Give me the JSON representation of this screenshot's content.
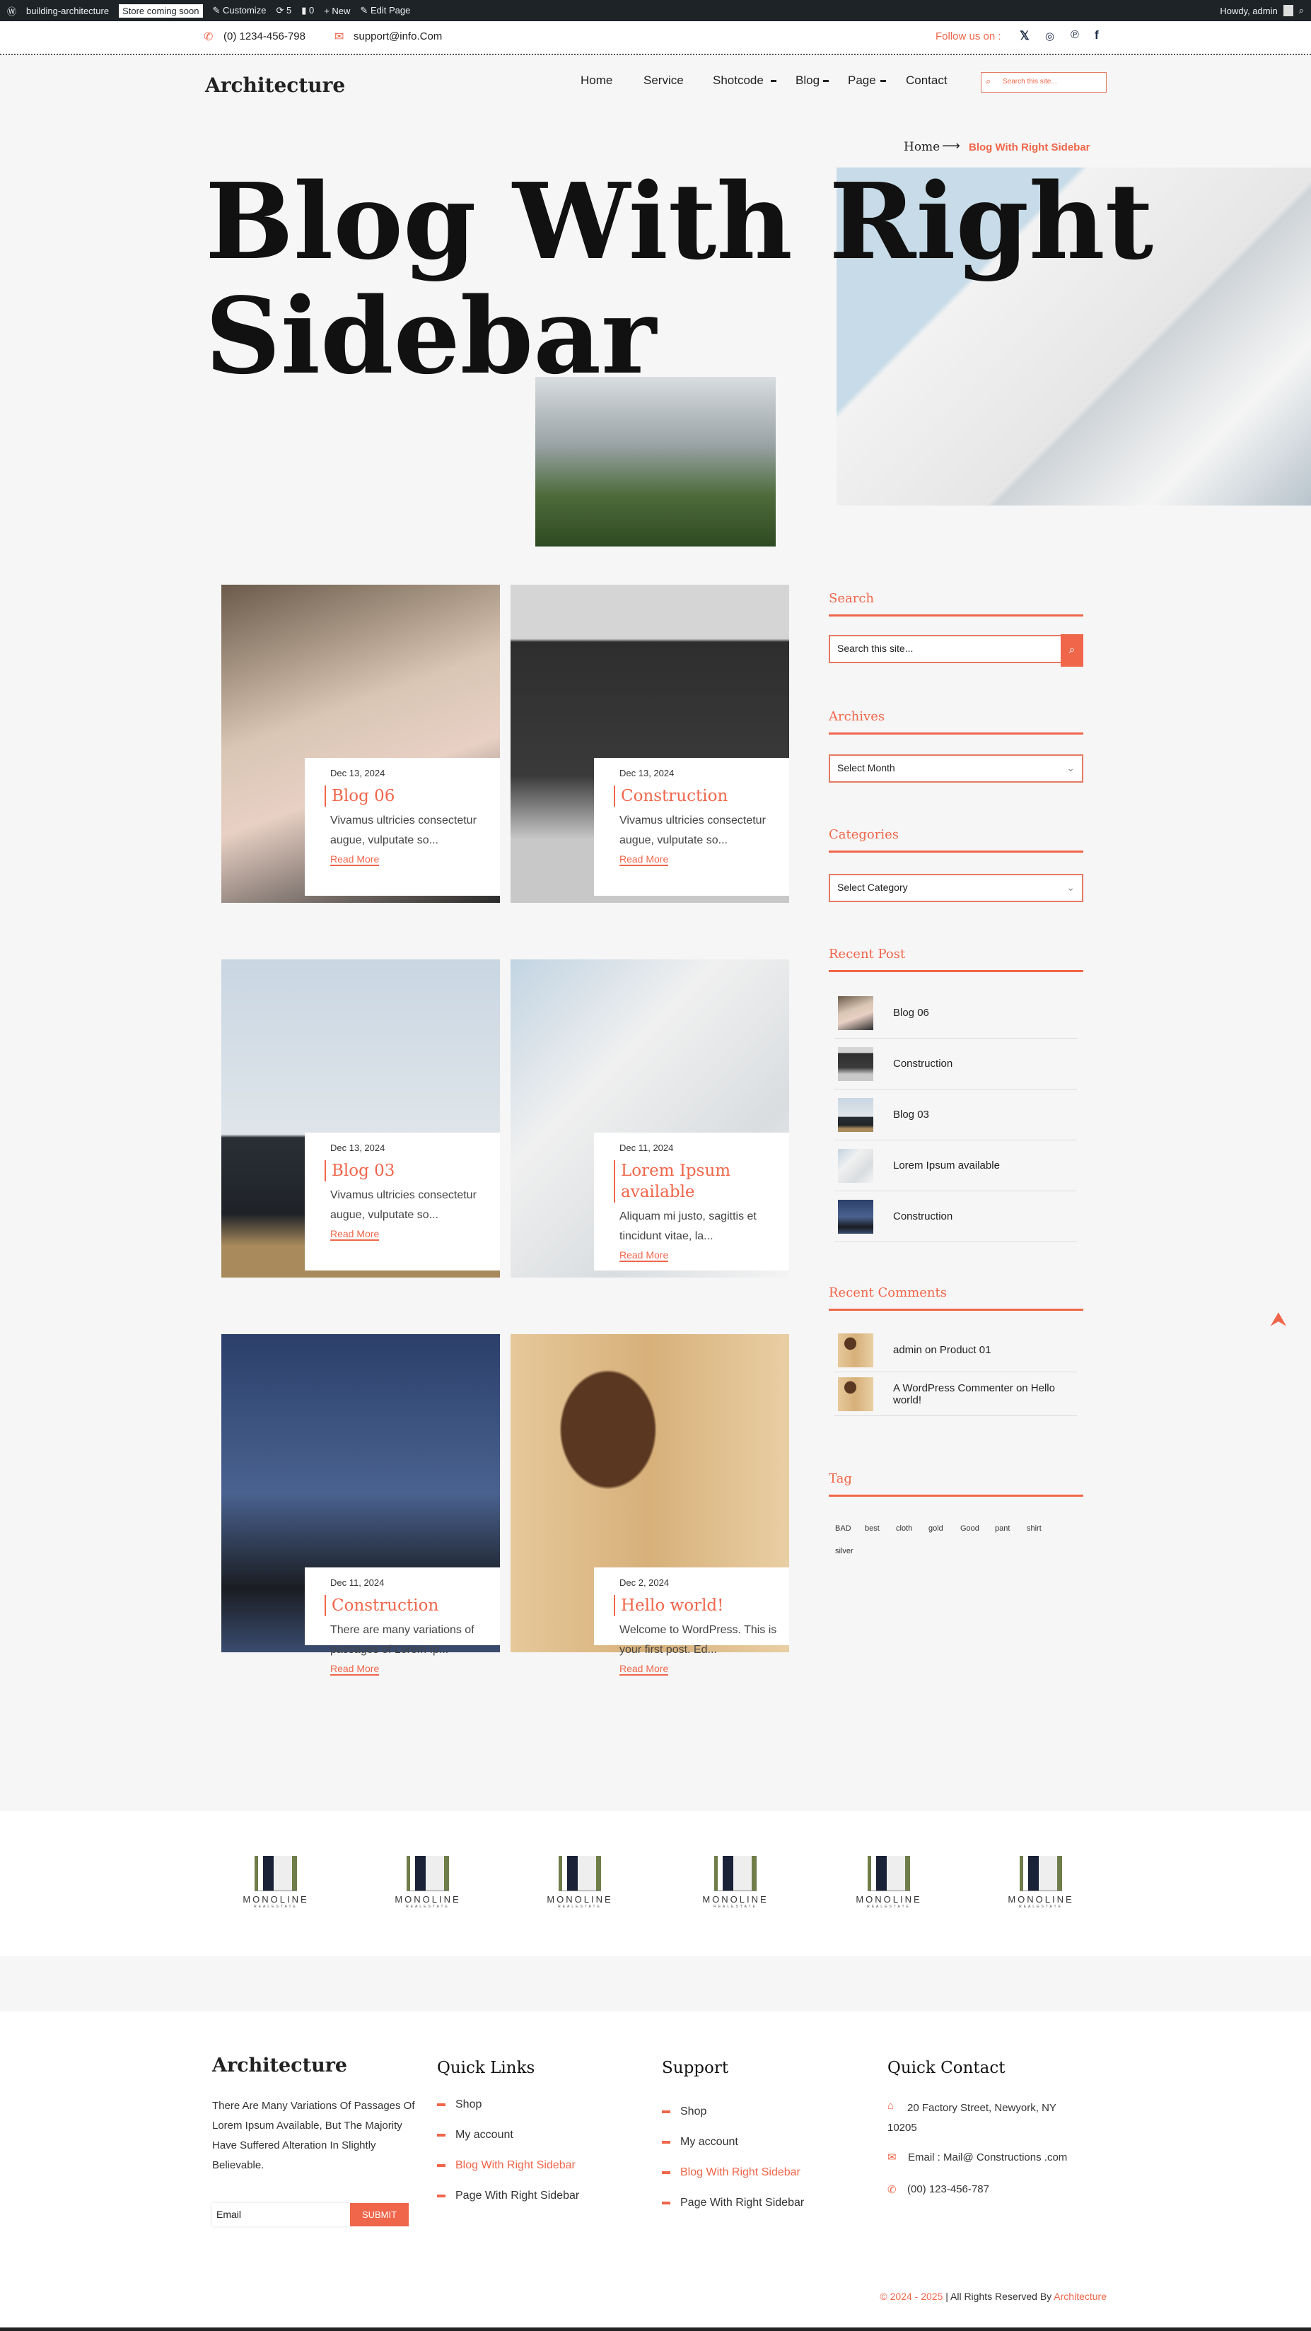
{
  "admin_bar": {
    "site": "building-architecture",
    "coming_soon": "Store coming soon",
    "customize": "Customize",
    "updates": "5",
    "comments": "0",
    "new": "New",
    "edit_page": "Edit Page",
    "howdy": "Howdy, admin"
  },
  "topbar": {
    "phone": "(0) 1234-456-798",
    "email": "support@info.Com",
    "follow": "Follow us on :"
  },
  "header": {
    "logo": "Architecture",
    "nav": [
      "Home",
      "Service",
      "Shotcode",
      "Blog",
      "Page",
      "Contact"
    ],
    "search_placeholder": "Search this site..."
  },
  "breadcrumb": {
    "home": "Home",
    "current": "Blog With Right Sidebar"
  },
  "hero": {
    "title_line1": "Blog With Right",
    "title_line2": "Sidebar"
  },
  "posts": [
    {
      "date": "Dec 13, 2024",
      "title": "Blog 06",
      "excerpt": "Vivamus ultricies consectetur augue, vulputate so...",
      "read_more": "Read More"
    },
    {
      "date": "Dec 13, 2024",
      "title": "Construction",
      "excerpt": "Vivamus ultricies consectetur augue, vulputate so...",
      "read_more": "Read More"
    },
    {
      "date": "Dec 13, 2024",
      "title": "Blog 03",
      "excerpt": "Vivamus ultricies consectetur augue, vulputate so...",
      "read_more": "Read More"
    },
    {
      "date": "Dec 11, 2024",
      "title": "Lorem Ipsum available",
      "excerpt": "Aliquam mi justo, sagittis et tincidunt vitae, la...",
      "read_more": "Read More"
    },
    {
      "date": "Dec 11, 2024",
      "title": "Construction",
      "excerpt": "There are many variations of passages of Lorem Ip...",
      "read_more": "Read More"
    },
    {
      "date": "Dec 2, 2024",
      "title": "Hello world!",
      "excerpt": "Welcome to WordPress. This is your first post. Ed...",
      "read_more": "Read More"
    }
  ],
  "sidebar": {
    "search_title": "Search",
    "search_placeholder": "Search this site...",
    "archives_title": "Archives",
    "archives_value": "Select Month",
    "categories_title": "Categories",
    "categories_value": "Select Category",
    "recent_post_title": "Recent Post",
    "recent_posts": [
      "Blog 06",
      "Construction",
      "Blog 03",
      "Lorem Ipsum available",
      "Construction"
    ],
    "recent_comments_title": "Recent Comments",
    "recent_comments": [
      "admin on Product 01",
      "A WordPress Commenter on Hello world!"
    ],
    "tag_title": "Tag",
    "tags": [
      "BAD",
      "best",
      "cloth",
      "gold",
      "Good",
      "pant",
      "shirt",
      "silver"
    ]
  },
  "partners": {
    "logo_text": "MONOLINE",
    "logo_sub": "REALESTATE"
  },
  "footer": {
    "logo": "Architecture",
    "about": "There Are Many Variations Of Passages Of Lorem Ipsum Available, But The Majority Have Suffered Alteration In Slightly Believable.",
    "email_placeholder": "Email",
    "submit": "SUBMIT",
    "quick_links_title": "Quick Links",
    "quick_links": [
      "Shop",
      "My account",
      "Blog With Right Sidebar",
      "Page With Right Sidebar"
    ],
    "support_title": "Support",
    "support_links": [
      "Shop",
      "My account",
      "Blog With Right Sidebar",
      "Page With Right Sidebar"
    ],
    "contact_title": "Quick Contact",
    "address": "20 Factory Street, Newyork, NY 10205",
    "contact_email": "Email : Mail@ Constructions .com",
    "contact_phone": "(00) 123-456-787",
    "copyright": "© 2024 - 2025",
    "rights": " | All Rights Reserved By ",
    "brand": "Architecture"
  },
  "colors": {
    "accent": "#f0664a",
    "admin_bar": "#1d2327"
  }
}
